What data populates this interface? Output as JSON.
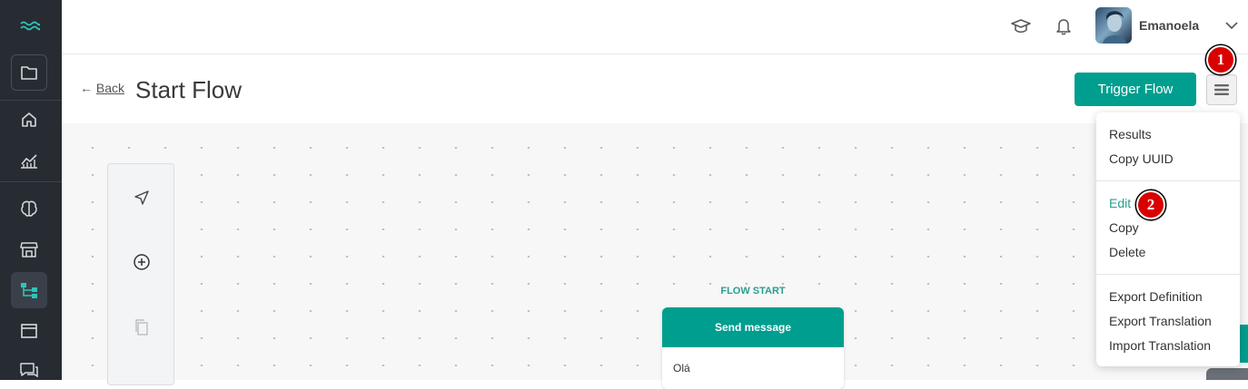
{
  "topbar": {
    "username": "Emanoela",
    "icons": [
      "graduation-cap-icon",
      "bell-icon",
      "chevron-down-icon"
    ]
  },
  "sidebar": {
    "items": [
      "logo-icon",
      "folder-icon",
      "home-icon",
      "analytics-icon",
      "brain-icon",
      "store-icon",
      "flows-icon",
      "window-icon",
      "chat-icon"
    ],
    "active": "flows-icon"
  },
  "header": {
    "back_arrow": "←",
    "back_label": "Back",
    "title": "Start Flow",
    "trigger_label": "Trigger Flow"
  },
  "toolbar": {
    "tools": [
      "send-icon",
      "add-circle-icon",
      "copy-icon"
    ]
  },
  "flow": {
    "start_label": "FLOW START",
    "node_title": "Send message",
    "node_text": "Olá"
  },
  "menu": {
    "group1": [
      "Results",
      "Copy UUID"
    ],
    "group2": [
      "Edit",
      "Copy",
      "Delete"
    ],
    "group3": [
      "Export Definition",
      "Export Translation",
      "Import Translation"
    ],
    "active_item": "Edit"
  },
  "annotations": {
    "badge1": "1",
    "badge2": "2"
  },
  "colors": {
    "accent": "#009e8e",
    "sidebar_bg": "#272c33",
    "badge_red": "#d90000"
  }
}
